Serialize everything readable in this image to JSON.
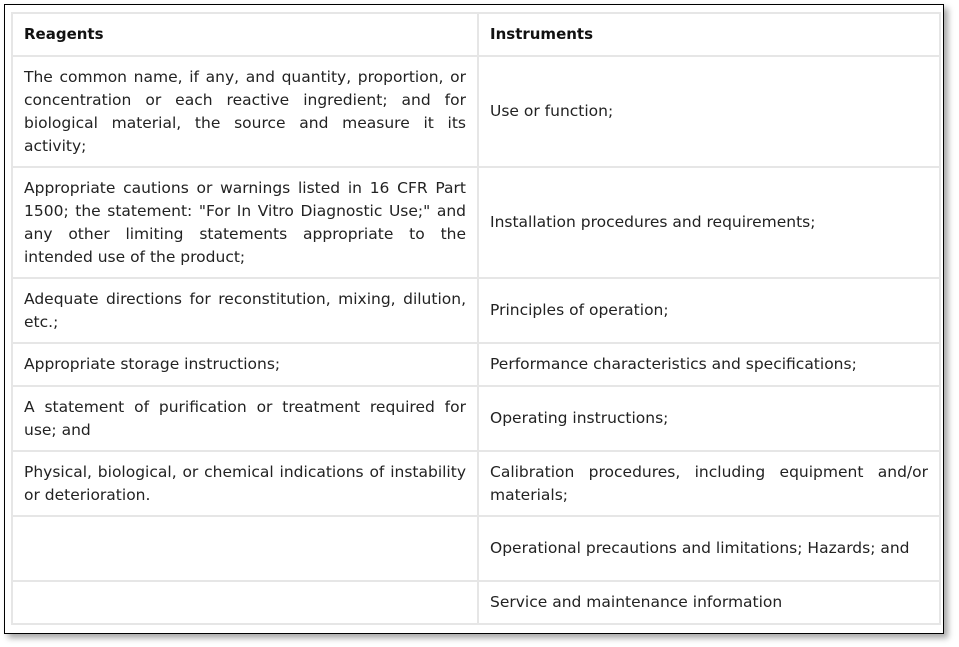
{
  "table": {
    "headers": [
      "Reagents",
      "Instruments"
    ],
    "rows": [
      {
        "reagent": "The common name, if any, and quantity, proportion, or concentration or each reactive ingredient; and for biological material, the source and measure it its activity;",
        "instrument": "Use or function;"
      },
      {
        "reagent": "Appropriate cautions or warnings listed in 16 CFR Part 1500; the statement: \"For In Vitro Diagnostic Use;\" and any other limiting statements appropriate to the intended use of the product;",
        "instrument": "Installation procedures and requirements;"
      },
      {
        "reagent": "Adequate directions for reconstitution, mixing, dilution, etc.;",
        "instrument": "Principles of operation;"
      },
      {
        "reagent": "Appropriate storage instructions;",
        "instrument": "Performance characteristics and specifications;"
      },
      {
        "reagent": "A statement of purification or treatment required for use; and",
        "instrument": "Operating instructions;"
      },
      {
        "reagent": "Physical, biological, or chemical indications of instability or deterioration.",
        "instrument": "Calibration procedures, including equipment and/or materials;"
      },
      {
        "reagent": "",
        "instrument": "Operational precautions and limitations; Hazards; and"
      },
      {
        "reagent": "",
        "instrument": "Service and maintenance information"
      }
    ]
  }
}
